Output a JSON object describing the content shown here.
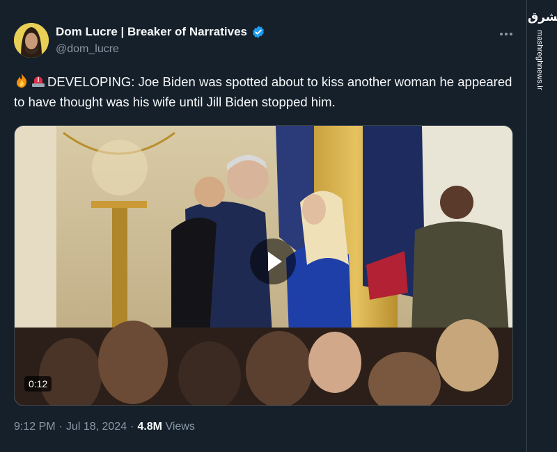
{
  "author": {
    "display_name": "Dom Lucre | Breaker of Narratives",
    "handle": "@dom_lucre",
    "verified": true
  },
  "tweet": {
    "emojis": [
      "fire-emoji",
      "siren-emoji"
    ],
    "text": "DEVELOPING: Joe Biden was spotted about to kiss another woman he appeared to have thought was his wife until Jill Biden stopped him.",
    "video_duration": "0:12",
    "time": "9:12 PM",
    "date": "Jul 18, 2024",
    "views_count": "4.8M",
    "views_label": "Views",
    "separator": "·"
  },
  "watermark": {
    "logo": "مشرق",
    "url": "mashreghnews.ir"
  },
  "colors": {
    "background": "#15202b",
    "text": "#f7f9f9",
    "secondary": "#8b98a5",
    "verified": "#1d9bf0"
  }
}
